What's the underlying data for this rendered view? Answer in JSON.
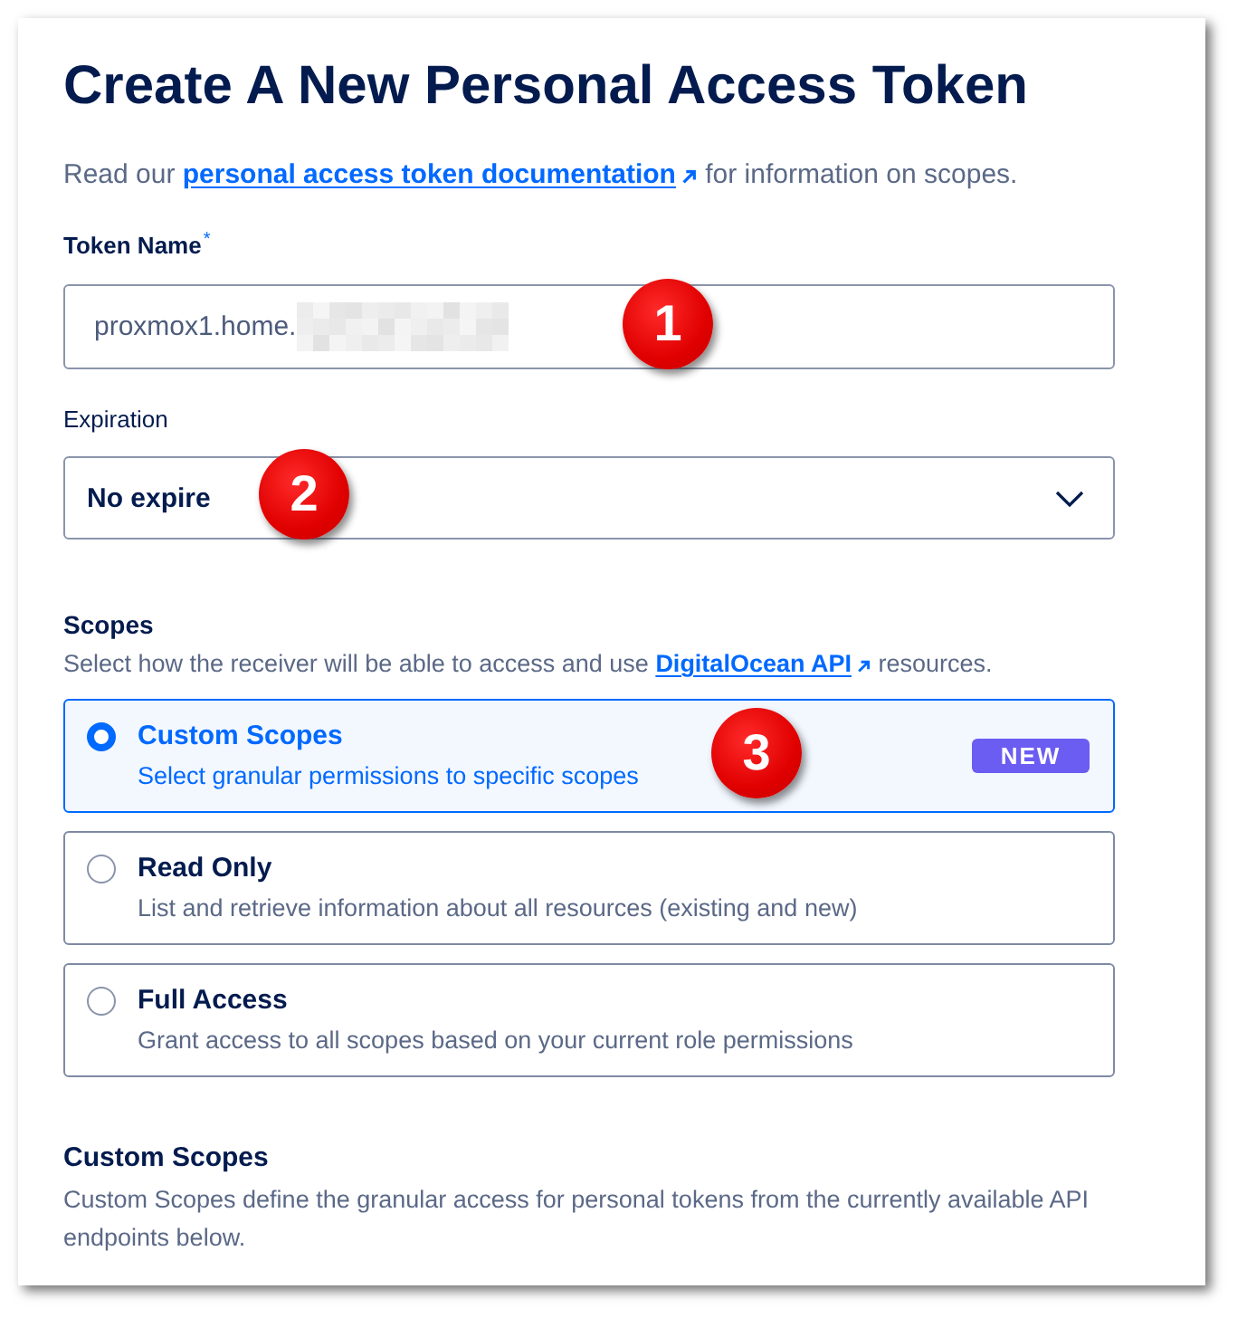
{
  "title": "Create A New Personal Access Token",
  "intro": {
    "text_before": "Read our",
    "link": "personal access token documentation",
    "text_after": "for information on scopes."
  },
  "token_name": {
    "label": "Token Name",
    "required_mark": "*",
    "value": "proxmox1.home.",
    "redacted": true,
    "marker": "1"
  },
  "expiration": {
    "label": "Expiration",
    "value": "No expire",
    "marker": "2"
  },
  "scopes": {
    "label": "Scopes",
    "hint": {
      "text_before": "Select how the receiver will be able to access and use",
      "link": "DigitalOcean API",
      "text_after": "resources."
    },
    "options": [
      {
        "title": "Custom Scopes",
        "description": "Select granular permissions to specific scopes",
        "selected": true,
        "badge": "NEW",
        "marker": "3"
      },
      {
        "title": "Read Only",
        "description": "List and retrieve information about all resources (existing and new)",
        "selected": false
      },
      {
        "title": "Full Access",
        "description": "Grant access to all scopes based on your current role permissions",
        "selected": false
      }
    ]
  },
  "custom_scopes": {
    "heading": "Custom Scopes",
    "description": "Custom Scopes define the granular access for personal tokens from the currently available API endpoints below."
  }
}
